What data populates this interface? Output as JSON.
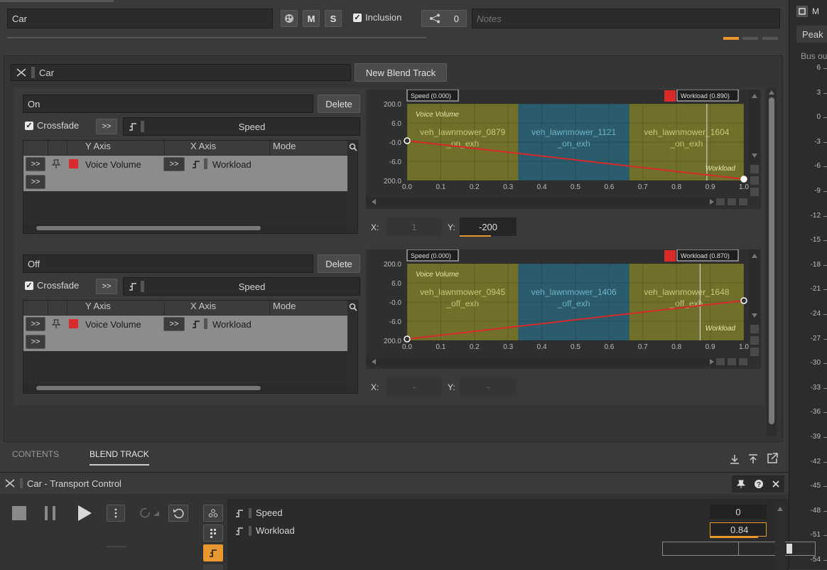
{
  "top": {
    "object_name": "Car",
    "m_label": "M",
    "s_label": "S",
    "inclusion_label": "Inclusion",
    "share_count": "0",
    "notes_placeholder": "Notes"
  },
  "side": {
    "peak_label": "Peak",
    "bus_label": "Bus ou",
    "m_label": "M"
  },
  "blend": {
    "name": "Car",
    "new_button": "New Blend Track",
    "tracks": [
      {
        "name": "On",
        "delete_label": "Delete",
        "crossfade_label": "Crossfade",
        "param": "Speed",
        "col_y": "Y Axis",
        "col_x": "X Axis",
        "col_mode": "Mode",
        "row_y": "Voice Volume",
        "row_x": "Workload",
        "graph": {
          "speed_tag": "Speed (0.000)",
          "workload_tag": "Workload (0.890)",
          "voice_volume": "Voice Volume",
          "workload_label": "Workload",
          "clips": [
            "veh_lawnmower_0879\n_on_exh",
            "veh_lawnmower_1121\n_on_exh",
            "veh_lawnmower_1604\n_on_exh"
          ],
          "y_ticks": [
            "200.0",
            "6.0",
            "-0.0",
            "-6.0",
            "200.0"
          ],
          "x_ticks": [
            "0.0",
            "0.1",
            "0.2",
            "0.3",
            "0.4",
            "0.5",
            "0.6",
            "0.7",
            "0.8",
            "0.9",
            "1.0"
          ],
          "curve": [
            [
              0.0,
              0.0
            ],
            [
              1.0,
              -200
            ]
          ],
          "marker_x": 0.89
        },
        "x_label": "X:",
        "x_value": "1",
        "y_label": "Y:",
        "y_value": "-200"
      },
      {
        "name": "Off",
        "delete_label": "Delete",
        "crossfade_label": "Crossfade",
        "param": "Speed",
        "col_y": "Y Axis",
        "col_x": "X Axis",
        "col_mode": "Mode",
        "row_y": "Voice Volume",
        "row_x": "Workload",
        "graph": {
          "speed_tag": "Speed (0.000)",
          "workload_tag": "Workload (0.870)",
          "voice_volume": "Voice Volume",
          "workload_label": "Workload",
          "clips": [
            "veh_lawnmower_0945\n_off_exh",
            "veh_lawnmower_1406\n_off_exh",
            "veh_lawnmower_1648\n_off_exh"
          ],
          "y_ticks": [
            "200.0",
            "6.0",
            "-0.0",
            "-6.0",
            "200.0"
          ],
          "x_ticks": [
            "0.0",
            "0.1",
            "0.2",
            "0.3",
            "0.4",
            "0.5",
            "0.6",
            "0.7",
            "0.8",
            "0.9",
            "1.0"
          ],
          "curve": [
            [
              0.0,
              -200
            ],
            [
              1.0,
              0.0
            ]
          ],
          "marker_x": 0.87
        },
        "x_label": "X:",
        "x_value": "-",
        "y_label": "Y:",
        "y_value": "-"
      }
    ]
  },
  "tabs": {
    "contents": "CONTENTS",
    "blend_track": "BLEND TRACK"
  },
  "transport": {
    "title": "Car - Transport Control",
    "params": [
      {
        "name": "Speed",
        "value": "0"
      },
      {
        "name": "Workload",
        "value": "0.84"
      }
    ]
  },
  "meter": {
    "ticks": [
      "6",
      "3",
      "0",
      "-3",
      "-6",
      "-9",
      "-12",
      "-15",
      "-18",
      "-21",
      "-24",
      "-27",
      "-30",
      "-33",
      "-36",
      "-39",
      "-42",
      "-45",
      "-48",
      "-51",
      "-54"
    ]
  },
  "colors": {
    "accent": "#e8962e",
    "clip_yellow": "#8a8a2e",
    "clip_blue": "#2e6f86",
    "curve_red": "#d62a2a",
    "color_red": "#d92b2b"
  }
}
